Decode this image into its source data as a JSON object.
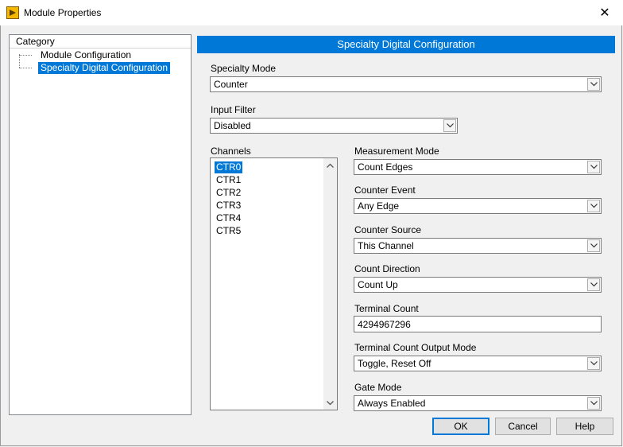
{
  "window": {
    "title": "Module Properties",
    "close_glyph": "✕"
  },
  "category": {
    "header": "Category",
    "items": [
      {
        "label": "Module Configuration",
        "selected": false
      },
      {
        "label": "Specialty Digital Configuration",
        "selected": true
      }
    ]
  },
  "panel": {
    "title": "Specialty Digital Configuration",
    "specialty_mode": {
      "label": "Specialty Mode",
      "value": "Counter"
    },
    "input_filter": {
      "label": "Input Filter",
      "value": "Disabled"
    },
    "channels": {
      "label": "Channels",
      "items": [
        "CTR0",
        "CTR1",
        "CTR2",
        "CTR3",
        "CTR4",
        "CTR5"
      ],
      "selected": "CTR0"
    },
    "measurement_mode": {
      "label": "Measurement Mode",
      "value": "Count Edges"
    },
    "counter_event": {
      "label": "Counter Event",
      "value": "Any Edge"
    },
    "counter_source": {
      "label": "Counter Source",
      "value": "This Channel"
    },
    "count_direction": {
      "label": "Count Direction",
      "value": "Count Up"
    },
    "terminal_count": {
      "label": "Terminal Count",
      "value": "4294967296"
    },
    "terminal_count_output_mode": {
      "label": "Terminal Count Output Mode",
      "value": "Toggle, Reset Off"
    },
    "gate_mode": {
      "label": "Gate Mode",
      "value": "Always Enabled"
    }
  },
  "buttons": {
    "ok": "OK",
    "cancel": "Cancel",
    "help": "Help"
  },
  "colors": {
    "accent": "#0078d7",
    "background": "#f0f0f0"
  },
  "icons": [
    "labview-app-icon",
    "close-icon",
    "chevron-down-icon",
    "scroll-up-icon",
    "scroll-down-icon"
  ]
}
